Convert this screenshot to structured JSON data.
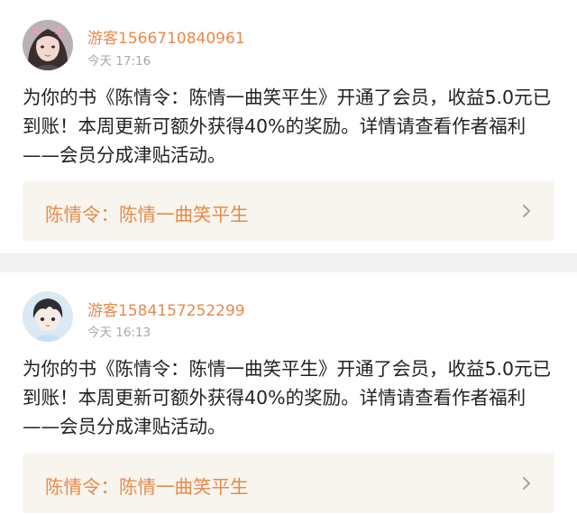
{
  "notifications": [
    {
      "username": "游客1566710840961",
      "time": "今天 17:16",
      "message": "为你的书《陈情令：陈情一曲笑平生》开通了会员，收益5.0元已到账！本周更新可额外获得40%的奖励。详情请查看作者福利——会员分成津贴活动。",
      "book_title": "陈情令：陈情一曲笑平生",
      "avatar_icon": "girl-avatar-icon",
      "chevron_icon": "chevron-right-icon"
    },
    {
      "username": "游客1584157252299",
      "time": "今天 16:13",
      "message": "为你的书《陈情令：陈情一曲笑平生》开通了会员，收益5.0元已到账！本周更新可额外获得40%的奖励。详情请查看作者福利——会员分成津贴活动。",
      "book_title": "陈情令：陈情一曲笑平生",
      "avatar_icon": "anime-boy-avatar-icon",
      "chevron_icon": "chevron-right-icon"
    }
  ],
  "colors": {
    "username": "#e8894a",
    "link_background": "#f7f5ee",
    "divider": "#f2f2f2"
  }
}
